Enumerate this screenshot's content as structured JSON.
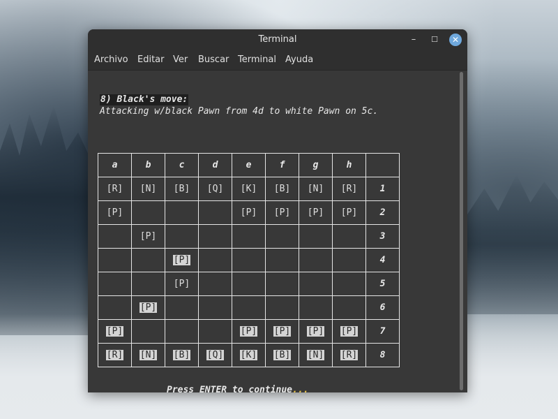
{
  "window": {
    "title": "Terminal"
  },
  "menu": [
    "Archivo",
    "Editar",
    "Ver",
    "Buscar",
    "Terminal",
    "Ayuda"
  ],
  "terminal": {
    "heading": "8) Black's move:",
    "subline": "Attacking w/black Pawn from 4d to white Pawn on 5c.",
    "prompt": "Press ENTER to continue",
    "prompt_dots": "...",
    "column_headers": [
      "a",
      "b",
      "c",
      "d",
      "e",
      "f",
      "g",
      "h",
      ""
    ],
    "rows": [
      {
        "rank": "1",
        "cells": [
          {
            "p": "[R]",
            "side": "b"
          },
          {
            "p": "[N]",
            "side": "b"
          },
          {
            "p": "[B]",
            "side": "b"
          },
          {
            "p": "[Q]",
            "side": "b"
          },
          {
            "p": "[K]",
            "side": "b"
          },
          {
            "p": "[B]",
            "side": "b"
          },
          {
            "p": "[N]",
            "side": "b"
          },
          {
            "p": "[R]",
            "side": "b"
          }
        ]
      },
      {
        "rank": "2",
        "cells": [
          {
            "p": "[P]",
            "side": "b"
          },
          {
            "p": "",
            "side": ""
          },
          {
            "p": "",
            "side": ""
          },
          {
            "p": "",
            "side": ""
          },
          {
            "p": "[P]",
            "side": "b"
          },
          {
            "p": "[P]",
            "side": "b"
          },
          {
            "p": "[P]",
            "side": "b"
          },
          {
            "p": "[P]",
            "side": "b"
          }
        ]
      },
      {
        "rank": "3",
        "cells": [
          {
            "p": "",
            "side": ""
          },
          {
            "p": "[P]",
            "side": "b"
          },
          {
            "p": "",
            "side": ""
          },
          {
            "p": "",
            "side": ""
          },
          {
            "p": "",
            "side": ""
          },
          {
            "p": "",
            "side": ""
          },
          {
            "p": "",
            "side": ""
          },
          {
            "p": "",
            "side": ""
          }
        ]
      },
      {
        "rank": "4",
        "cells": [
          {
            "p": "",
            "side": ""
          },
          {
            "p": "",
            "side": ""
          },
          {
            "p": "[P]",
            "side": "w"
          },
          {
            "p": "",
            "side": ""
          },
          {
            "p": "",
            "side": ""
          },
          {
            "p": "",
            "side": ""
          },
          {
            "p": "",
            "side": ""
          },
          {
            "p": "",
            "side": ""
          }
        ]
      },
      {
        "rank": "5",
        "cells": [
          {
            "p": "",
            "side": ""
          },
          {
            "p": "",
            "side": ""
          },
          {
            "p": "[P]",
            "side": "b"
          },
          {
            "p": "",
            "side": ""
          },
          {
            "p": "",
            "side": ""
          },
          {
            "p": "",
            "side": ""
          },
          {
            "p": "",
            "side": ""
          },
          {
            "p": "",
            "side": ""
          }
        ]
      },
      {
        "rank": "6",
        "cells": [
          {
            "p": "",
            "side": ""
          },
          {
            "p": "[P]",
            "side": "w"
          },
          {
            "p": "",
            "side": ""
          },
          {
            "p": "",
            "side": ""
          },
          {
            "p": "",
            "side": ""
          },
          {
            "p": "",
            "side": ""
          },
          {
            "p": "",
            "side": ""
          },
          {
            "p": "",
            "side": ""
          }
        ]
      },
      {
        "rank": "7",
        "cells": [
          {
            "p": "[P]",
            "side": "w"
          },
          {
            "p": "",
            "side": ""
          },
          {
            "p": "",
            "side": ""
          },
          {
            "p": "",
            "side": ""
          },
          {
            "p": "[P]",
            "side": "w"
          },
          {
            "p": "[P]",
            "side": "w"
          },
          {
            "p": "[P]",
            "side": "w"
          },
          {
            "p": "[P]",
            "side": "w"
          }
        ]
      },
      {
        "rank": "8",
        "cells": [
          {
            "p": "[R]",
            "side": "w"
          },
          {
            "p": "[N]",
            "side": "w"
          },
          {
            "p": "[B]",
            "side": "w"
          },
          {
            "p": "[Q]",
            "side": "w"
          },
          {
            "p": "[K]",
            "side": "w"
          },
          {
            "p": "[B]",
            "side": "w"
          },
          {
            "p": "[N]",
            "side": "w"
          },
          {
            "p": "[R]",
            "side": "w"
          }
        ]
      }
    ]
  },
  "colors": {
    "terminal_bg": "#383838",
    "close_button": "#6fa8dc",
    "dots": "#e8c24a"
  }
}
